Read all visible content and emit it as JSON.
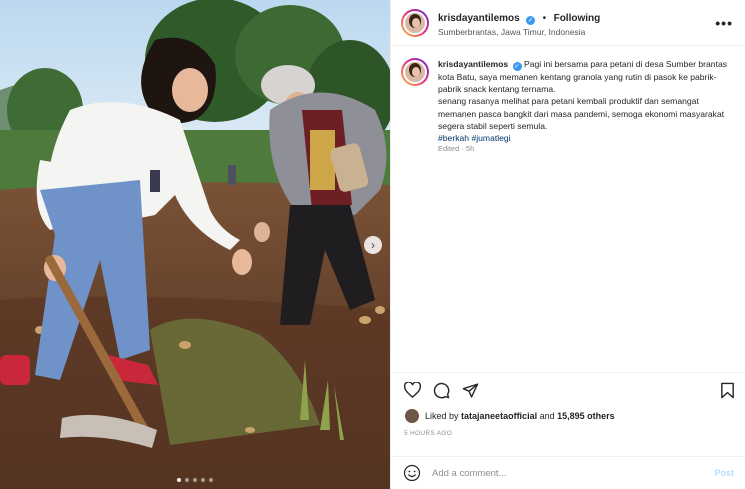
{
  "post": {
    "username": "krisdayantilemos",
    "separator": "•",
    "follow_status": "Following",
    "location": "Sumberbrantas, Jawa Timur, Indonesia",
    "more_icon": "more-horizontal-icon"
  },
  "caption": {
    "username": "krisdayantilemos",
    "line1": "Pagi ini bersama para petani di desa Sumber brantas kota Batu, saya memanen kentang granola yang rutin di pasok ke pabrik-pabrik snack kentang ternama.",
    "line2": "senang rasanya melihat para petani kembali produktif dan semangat memanen pasca bangkit dari masa pandemi, semoga ekonomi masyarakat segera stabil seperti semula.",
    "hashtag1": "#berkah",
    "hashtag2": "#jumatlegi",
    "edited": "Edited · 5h"
  },
  "actions": {
    "like_icon": "heart-icon",
    "comment_icon": "comment-icon",
    "share_icon": "send-icon",
    "save_icon": "bookmark-icon"
  },
  "likes": {
    "prefix": "Liked by",
    "liker": "tatajaneetaofficial",
    "and": "and",
    "others": "15,895 others"
  },
  "timeago": "5 HOURS AGO",
  "comment": {
    "placeholder": "Add a comment...",
    "post_label": "Post"
  },
  "carousel": {
    "slide_count": 5,
    "active_index": 0
  },
  "colors": {
    "link": "#00376b",
    "verified": "#3897f0",
    "muted": "#8e8e8e",
    "post_disabled": "#b2dffc"
  }
}
